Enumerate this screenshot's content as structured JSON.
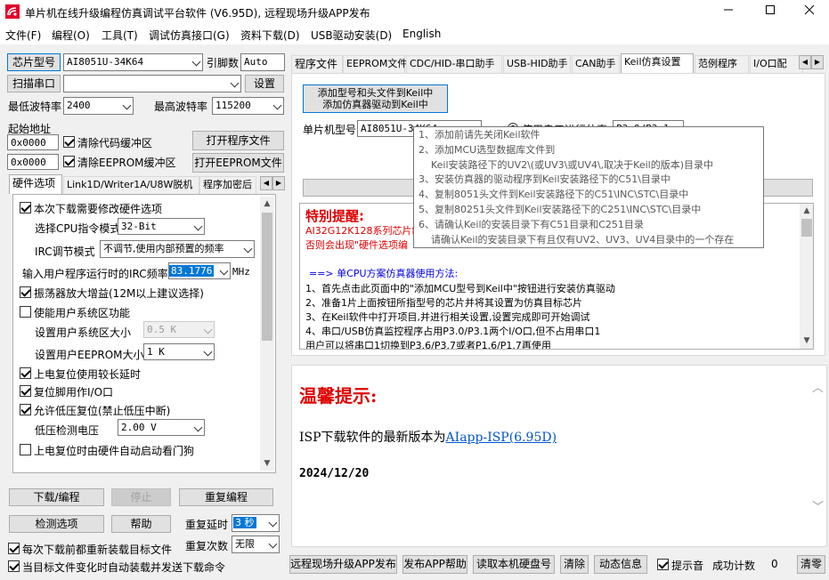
{
  "window": {
    "title": "单片机在线升级编程仿真调试平台软件 (V6.95D), 远程现场升级APP发布"
  },
  "menu": [
    "文件(F)",
    "编程(O)",
    "工具(T)",
    "调试仿真接口(G)",
    "资料下载(D)",
    "USB驱动安装(D)",
    "English"
  ],
  "left": {
    "chip_button": "芯片型号",
    "chip_value": "AI8051U-34K64",
    "pin_label": "引脚数",
    "pin_value": "Auto",
    "scan_button": "扫描串口",
    "port_value": "",
    "settings_button": "设置",
    "min_baud_label": "最低波特率",
    "min_baud_value": "2400",
    "max_baud_label": "最高波特率",
    "max_baud_value": "115200",
    "start_addr_label": "起始地址",
    "addr1": "0x0000",
    "clear_code_label": "清除代码缓冲区",
    "open_program_button": "打开程序文件",
    "addr2": "0x0000",
    "clear_eeprom_label": "清除EEPROM缓冲区",
    "open_eeprom_button": "打开EEPROM文件",
    "tabs": [
      "硬件选项",
      "Link1D/Writer1A/U8W脱机",
      "程序加密后"
    ],
    "hw": {
      "modify_hw": "本次下载需要修改硬件选项",
      "cpu_mode_label": "选择CPU指令模式",
      "cpu_mode_value": "32-Bit",
      "irc_mode_label": "IRC调节模式",
      "irc_mode_value": "不调节,使用内部预置的频率",
      "irc_freq_label": "输入用户程序运行时的IRC频率",
      "irc_freq_value": "83.1776",
      "irc_unit": "MHz",
      "osc_gain": "振荡器放大增益(12M以上建议选择)",
      "user_sys": "使能用户系统区功能",
      "user_sys_size_label": "设置用户系统区大小",
      "user_sys_size_value": "0.5 K",
      "user_eeprom_label": "设置用户EEPROM大小",
      "user_eeprom_value": "1  K",
      "long_reset": "上电复位使用较长延时",
      "reset_io": "复位脚用作I/O口",
      "lvd_reset": "允许低压复位(禁止低压中断)",
      "lvd_voltage_label": "低压检测电压",
      "lvd_voltage_value": "2.00 V",
      "watchdog": "上电复位时由硬件自动启动看门狗"
    },
    "download_button": "下载/编程",
    "stop_button": "停止",
    "reprogram_button": "重复编程",
    "check_button": "检测选项",
    "help_button": "帮助",
    "repeat_delay_label": "重复延时",
    "repeat_delay_value": "3 秒",
    "repeat_count_label": "重复次数",
    "repeat_count_value": "无限",
    "reload_each": "每次下载前都重新装载目标文件",
    "auto_reload": "当目标文件变化时自动装载并发送下载命令"
  },
  "right": {
    "tabs": [
      "程序文件",
      "EEPROM文件",
      "CDC/HID-串口助手",
      "USB-HID助手",
      "CAN助手",
      "Keil仿真设置",
      "范例程序",
      "I/O口配"
    ],
    "add_keil_line1": "添加型号和头文件到Keil中",
    "add_keil_line2": "添加仿真器驱动到Keil中",
    "chip_model_label": "单片机型号",
    "chip_model_value": "AI8051U-34K64",
    "use_serial_label": "使用串口进行仿真",
    "serial_value": "P3.0/P3.1",
    "tooltip": [
      "1、添加前请先关闭Keil软件",
      "2、添加MCU选型数据库文件到",
      "    Keil安装路径下的UV2\\(或UV3\\或UV4\\,取决于Keil的版本)目录中",
      "3、安装仿真器的驱动程序到Keil安装路径下的C51\\目录中",
      "4、复制8051头文件到Keil安装路径下的C51\\INC\\STC\\目录中",
      "5、复制80251头文件到Keil安装路径下的C251\\INC\\STC\\目录中",
      "6、请确认Keil的安装目录下有C51目录和C251目录",
      "    请确认Keil的安装目录下有且仅有UV2、UV3、UV4目录中的一个存在"
    ],
    "special_title": "特别提醒:",
    "special_line1": "AI32G12K128系列芯片制",
    "special_line2": "否则会出现\"硬件选项编",
    "instructions_title": "==> 单CPU方案仿真器使用方法:",
    "instructions": [
      "1、首先点击此页面中的\"添加MCU型号到Keil中\"按钮进行安装仿真驱动",
      "2、准备1片上面按钮所指型号的芯片并将其设置为仿真目标芯片",
      "3、在Keil软件中打开项目,并进行相关设置,设置完成即可开始调试",
      "4、串口/USB仿真监控程序占用P3.0/P3.1两个I/O口,但不占用串口1",
      "    用户可以将串口1切换到P3.6/P3.7或者P1.6/P1.7再使用"
    ],
    "notice_title": "温馨提示:",
    "notice_version_prefix": "ISP下载软件的最新版本为",
    "notice_version_link": "AIapp-ISP(6.95D)",
    "notice_date": "2024/12/20",
    "bottom": {
      "remote_upgrade": "远程现场升级APP发布",
      "publish_help": "发布APP帮助",
      "read_disk": "读取本机硬盘号",
      "clear": "清除",
      "dynamic_info": "动态信息",
      "beep_label": "提示音",
      "success_label": "成功计数",
      "success_count": "0",
      "clear_zero": "清零"
    }
  }
}
